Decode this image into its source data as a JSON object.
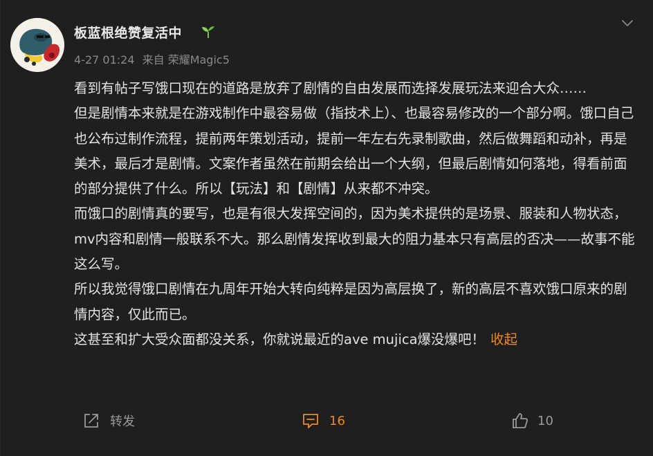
{
  "post": {
    "author": "板蓝根绝赞复活中",
    "badge_icon": "sprout-icon",
    "time": "4-27 01:24",
    "source": "来自 荣耀Magic5",
    "paragraphs": [
      "看到有帖子写饿口现在的道路是放弃了剧情的自由发展而选择发展玩法来迎合大众……",
      "但是剧情本来就是在游戏制作中最容易做（指技术上）、也最容易修改的一个部分啊。饿口自己也公布过制作流程，提前两年策划活动，提前一年左右先录制歌曲，然后做舞蹈和动补，再是美术，最后才是剧情。文案作者虽然在前期会给出一个大纲，但最后剧情如何落地，得看前面的部分提供了什么。所以【玩法】和【剧情】从来都不冲突。",
      "而饿口的剧情真的要写，也是有很大发挥空间的，因为美术提供的是场景、服装和人物状态，mv内容和剧情一般联系不大。那么剧情发挥收到最大的阻力基本只有高层的否决——故事不能这么写。",
      "所以我觉得饿口剧情在九周年开始大转向纯粹是因为高层换了，新的高层不喜欢饿口原来的剧情内容，仅此而已。",
      "这甚至和扩大受众面都没关系，你就说最近的ave mujica爆没爆吧！"
    ],
    "collapse_label": "收起"
  },
  "actions": {
    "repost_label": "转发",
    "comment_count": "16",
    "like_count": "10"
  },
  "colors": {
    "background": "#1f1f1f",
    "accent": "#f28a1a",
    "text": "#e3e3e3",
    "muted": "#8a8a8a"
  }
}
